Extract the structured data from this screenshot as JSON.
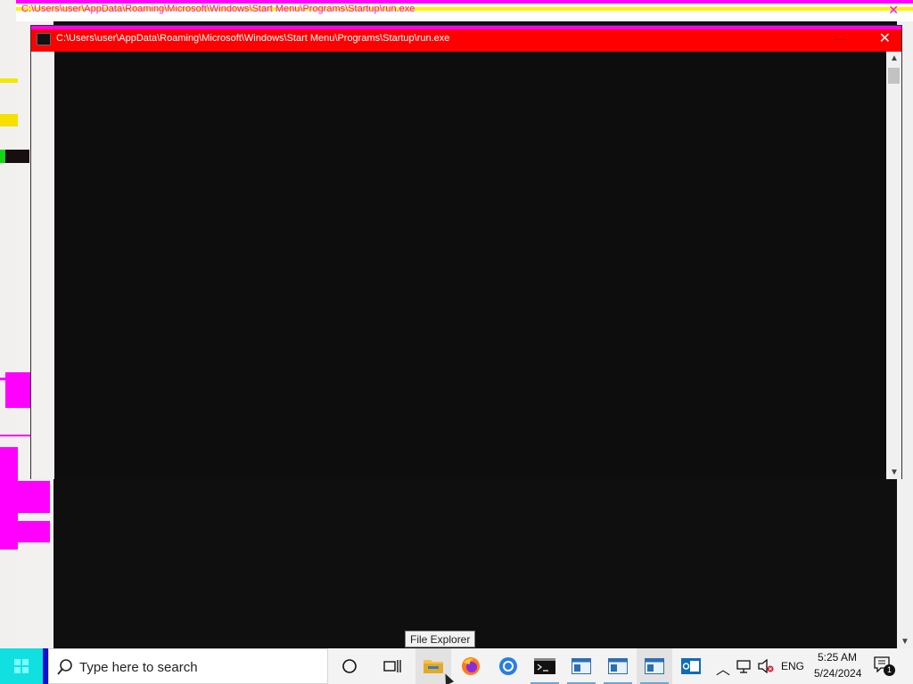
{
  "back_window": {
    "title": "C:\\Users\\user\\AppData\\Roaming\\Microsoft\\Windows\\Start Menu\\Programs\\Startup\\run.exe"
  },
  "front_window": {
    "title": "C:\\Users\\user\\AppData\\Roaming\\Microsoft\\Windows\\Start Menu\\Programs\\Startup\\run.exe",
    "minimize_glyph": "—",
    "close_glyph": "✕"
  },
  "tooltip": {
    "text": "File Explorer"
  },
  "taskbar": {
    "search_placeholder": "Type here to search",
    "apps": [
      {
        "name": "cortana-icon"
      },
      {
        "name": "task-view-icon"
      },
      {
        "name": "file-explorer-icon",
        "state": "hover"
      },
      {
        "name": "firefox-icon"
      },
      {
        "name": "chrome-icon"
      },
      {
        "name": "terminal-icon",
        "state": "running"
      },
      {
        "name": "window-icon-1",
        "state": "running"
      },
      {
        "name": "window-icon-2",
        "state": "running"
      },
      {
        "name": "window-icon-3",
        "state": "active"
      },
      {
        "name": "outlook-icon"
      }
    ],
    "tray": {
      "language": "ENG",
      "time": "5:25 AM",
      "date": "5/24/2024",
      "notification_count": "1"
    }
  },
  "colors": {
    "titlebar_red": "#ff0000",
    "glitch_magenta": "#ff00ff",
    "glitch_yellow": "#fff200",
    "start_cyan": "#10e0e0"
  }
}
